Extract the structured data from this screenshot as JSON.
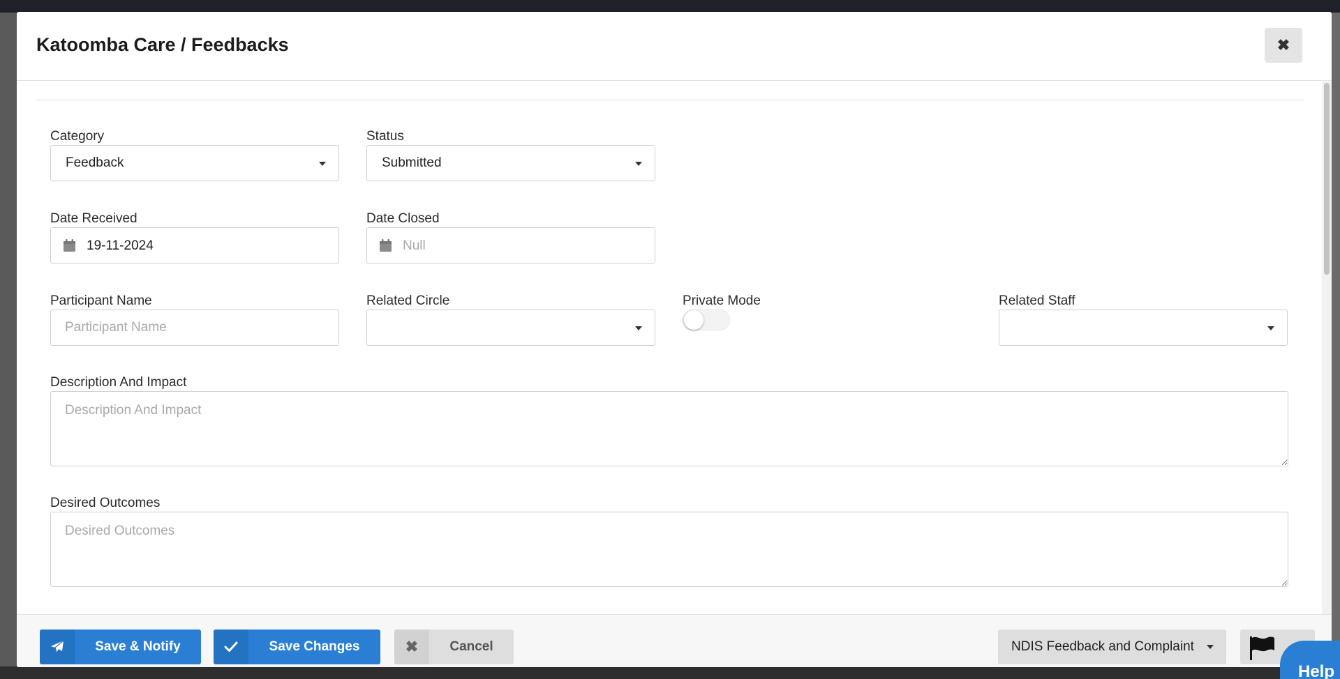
{
  "modal": {
    "title": "Katoomba Care / Feedbacks",
    "close_label": "✖"
  },
  "form": {
    "category": {
      "label": "Category",
      "value": "Feedback"
    },
    "status": {
      "label": "Status",
      "value": "Submitted"
    },
    "date_received": {
      "label": "Date Received",
      "value": "19-11-2024"
    },
    "date_closed": {
      "label": "Date Closed",
      "placeholder": "Null"
    },
    "participant_name": {
      "label": "Participant Name",
      "placeholder": "Participant Name"
    },
    "related_circle": {
      "label": "Related Circle",
      "value": ""
    },
    "private_mode": {
      "label": "Private Mode",
      "enabled": false
    },
    "related_staff": {
      "label": "Related Staff",
      "value": ""
    },
    "description": {
      "label": "Description And Impact",
      "placeholder": "Description And Impact"
    },
    "desired_outcomes": {
      "label": "Desired Outcomes",
      "placeholder": "Desired Outcomes"
    }
  },
  "footer": {
    "save_notify_label": "Save & Notify",
    "save_changes_label": "Save Changes",
    "cancel_label": "Cancel",
    "form_type_label": "NDIS Feedback and Complaint"
  },
  "help_label": "Help",
  "colors": {
    "primary": "#2a7fd4",
    "primary_dark": "#2473c2",
    "neutral_button": "#dedede",
    "border": "#cfcfcf"
  },
  "icons": [
    "close-icon",
    "calendar-icon",
    "chevron-down-icon",
    "paper-plane-icon",
    "check-icon",
    "times-icon",
    "flag-icon"
  ]
}
